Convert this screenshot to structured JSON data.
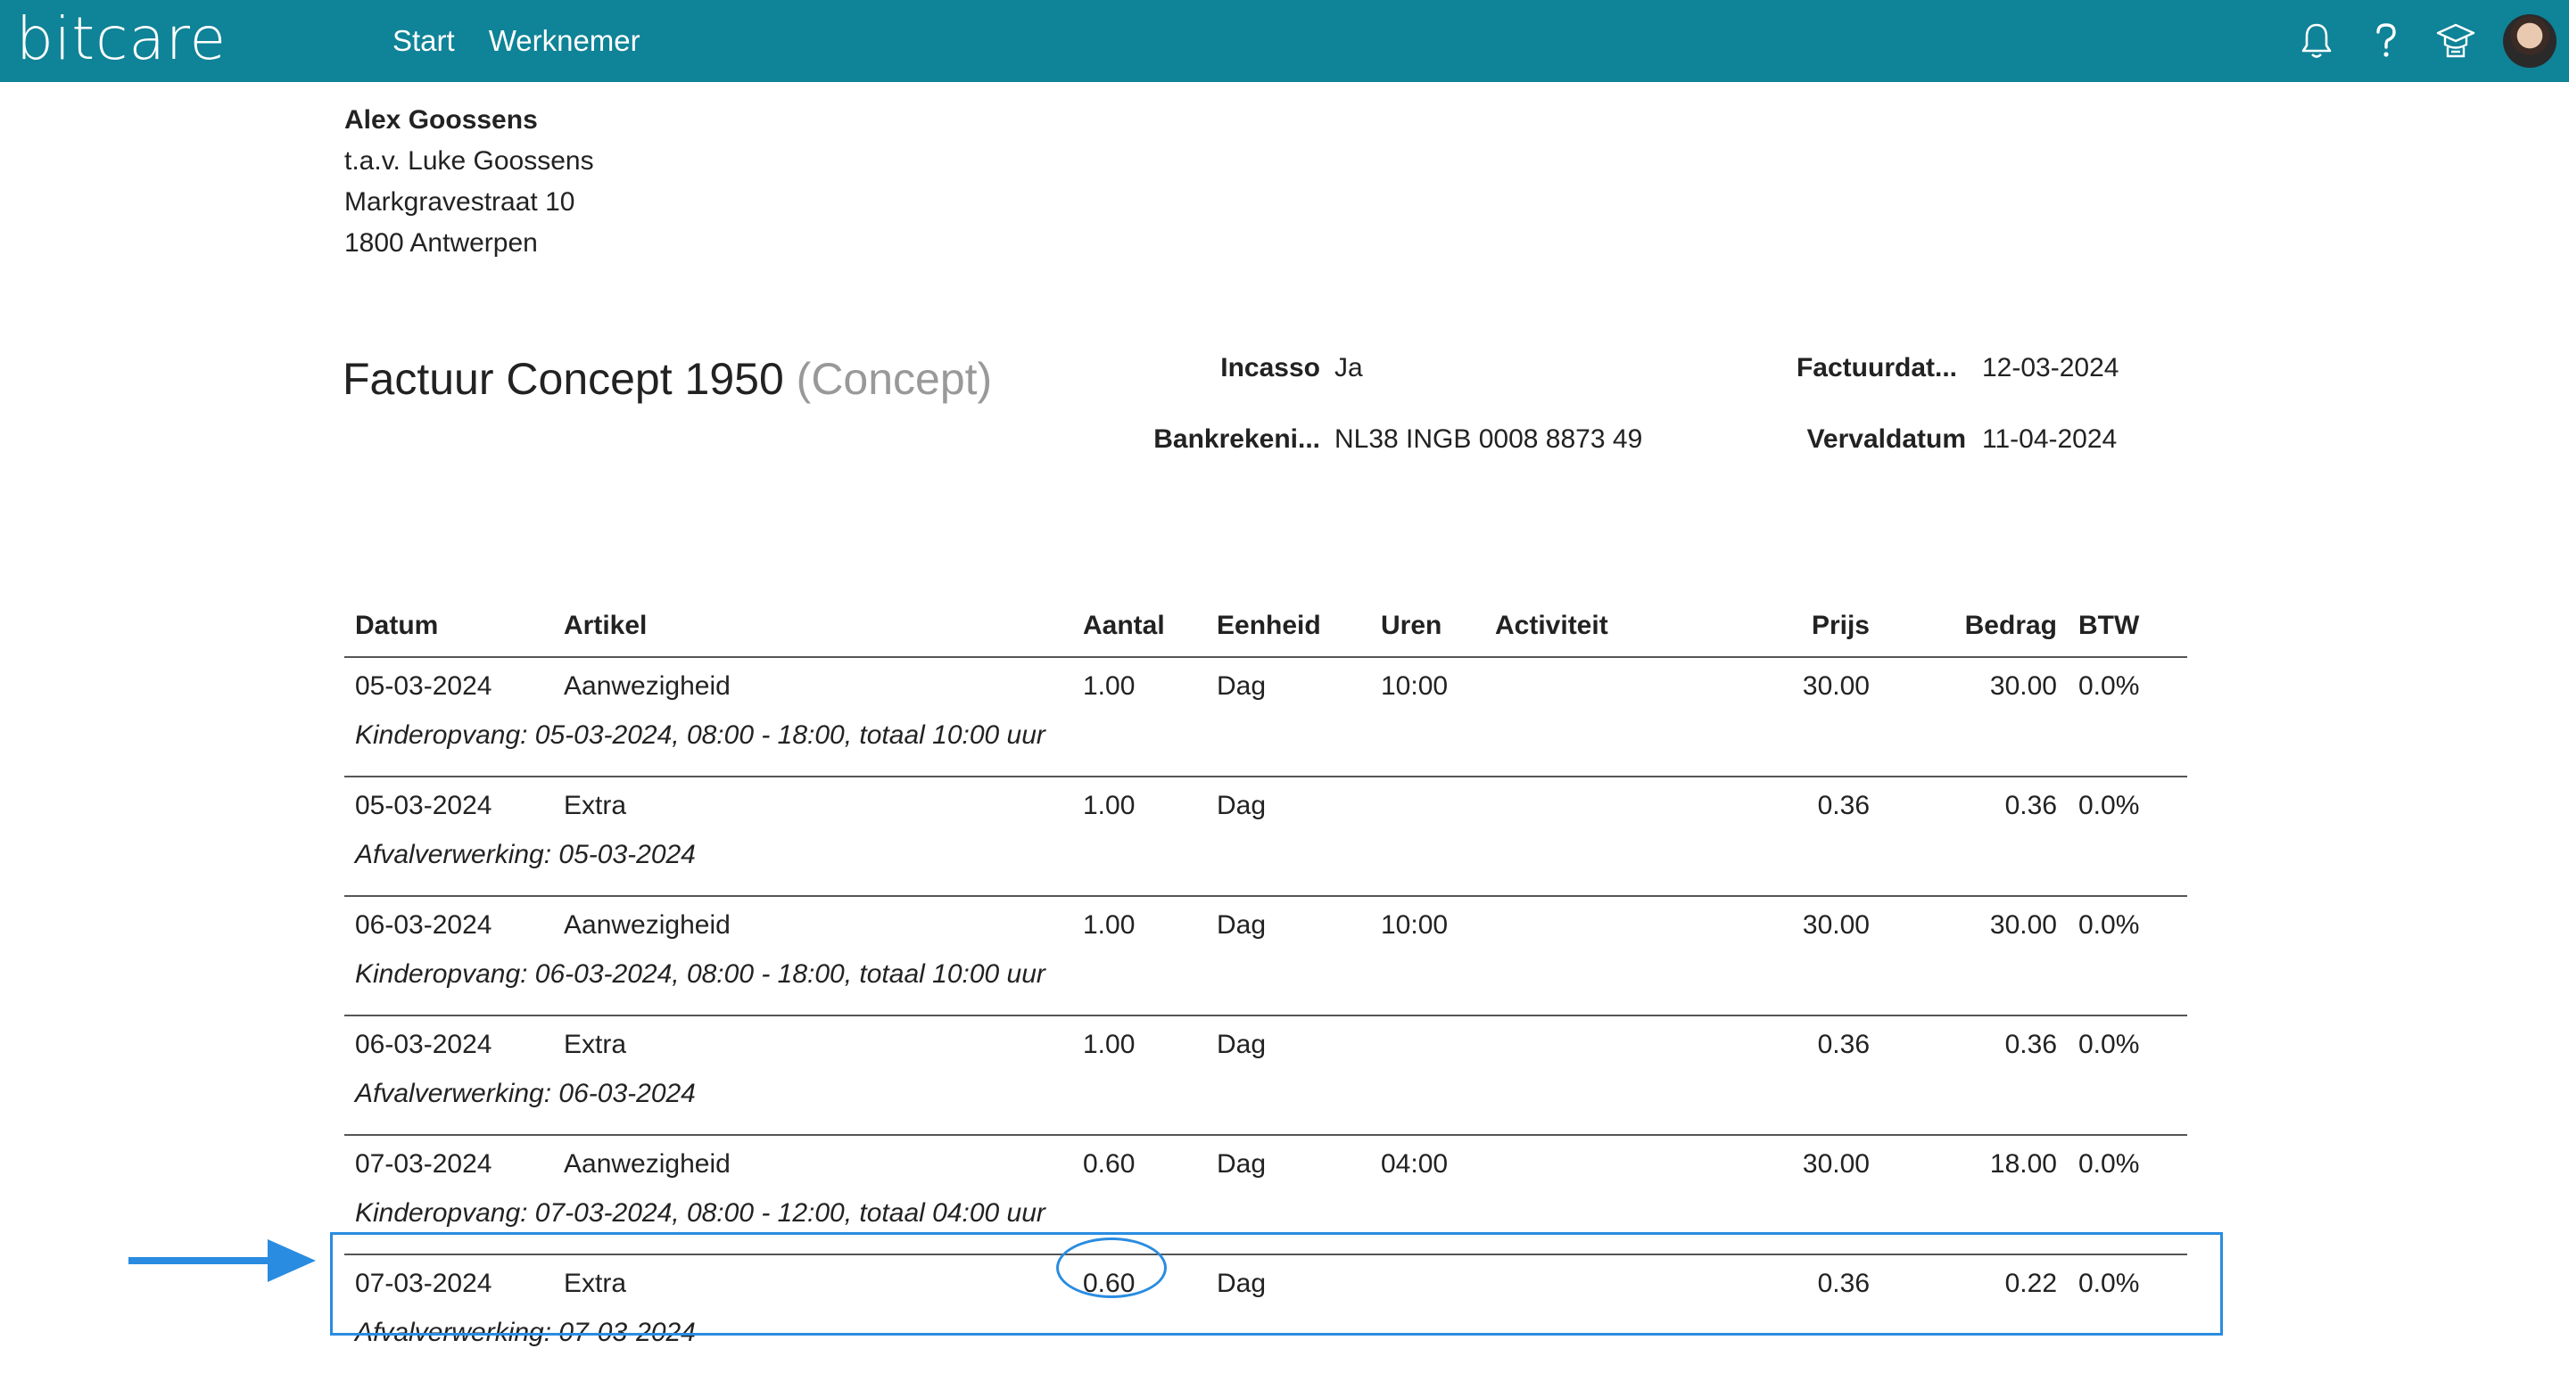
{
  "app": {
    "logo": "bitcare"
  },
  "nav": {
    "items": [
      "Start",
      "Werknemer"
    ]
  },
  "header_icons": [
    "bell-icon",
    "help-icon",
    "graduation-icon",
    "avatar"
  ],
  "address": {
    "name": "Alex Goossens",
    "attn": "t.a.v. Luke Goossens",
    "street": "Markgravestraat 10",
    "city": "1800 Antwerpen"
  },
  "invoice": {
    "title": "Factuur Concept 1950",
    "status": "(Concept)",
    "incasso_label": "Incasso",
    "incasso_value": "Ja",
    "bank_label": "Bankrekeni...",
    "bank_value": "NL38 INGB 0008 8873 49",
    "date_label": "Factuurdat...",
    "date_value": "12-03-2024",
    "due_label": "Vervaldatum",
    "due_value": "11-04-2024"
  },
  "table": {
    "columns": [
      "Datum",
      "Artikel",
      "Aantal",
      "Eenheid",
      "Uren",
      "Activiteit",
      "Prijs",
      "Bedrag",
      "BTW"
    ],
    "rows": [
      {
        "datum": "05-03-2024",
        "artikel": "Aanwezigheid",
        "aantal": "1.00",
        "eenheid": "Dag",
        "uren": "10:00",
        "activiteit": "",
        "prijs": "30.00",
        "bedrag": "30.00",
        "btw": "0.0%",
        "note": "Kinderopvang: 05-03-2024, 08:00 - 18:00, totaal 10:00 uur"
      },
      {
        "datum": "05-03-2024",
        "artikel": "Extra",
        "aantal": "1.00",
        "eenheid": "Dag",
        "uren": "",
        "activiteit": "",
        "prijs": "0.36",
        "bedrag": "0.36",
        "btw": "0.0%",
        "note": "Afvalverwerking: 05-03-2024"
      },
      {
        "datum": "06-03-2024",
        "artikel": "Aanwezigheid",
        "aantal": "1.00",
        "eenheid": "Dag",
        "uren": "10:00",
        "activiteit": "",
        "prijs": "30.00",
        "bedrag": "30.00",
        "btw": "0.0%",
        "note": "Kinderopvang: 06-03-2024, 08:00 - 18:00, totaal 10:00 uur"
      },
      {
        "datum": "06-03-2024",
        "artikel": "Extra",
        "aantal": "1.00",
        "eenheid": "Dag",
        "uren": "",
        "activiteit": "",
        "prijs": "0.36",
        "bedrag": "0.36",
        "btw": "0.0%",
        "note": "Afvalverwerking: 06-03-2024"
      },
      {
        "datum": "07-03-2024",
        "artikel": "Aanwezigheid",
        "aantal": "0.60",
        "eenheid": "Dag",
        "uren": "04:00",
        "activiteit": "",
        "prijs": "30.00",
        "bedrag": "18.00",
        "btw": "0.0%",
        "note": "Kinderopvang: 07-03-2024, 08:00 - 12:00, totaal 04:00 uur"
      },
      {
        "datum": "07-03-2024",
        "artikel": "Extra",
        "aantal": "0.60",
        "eenheid": "Dag",
        "uren": "",
        "activiteit": "",
        "prijs": "0.36",
        "bedrag": "0.22",
        "btw": "0.0%",
        "note": "Afvalverwerking: 07-03-2024"
      }
    ]
  },
  "annotation": {
    "color": "#2a8ce0"
  }
}
